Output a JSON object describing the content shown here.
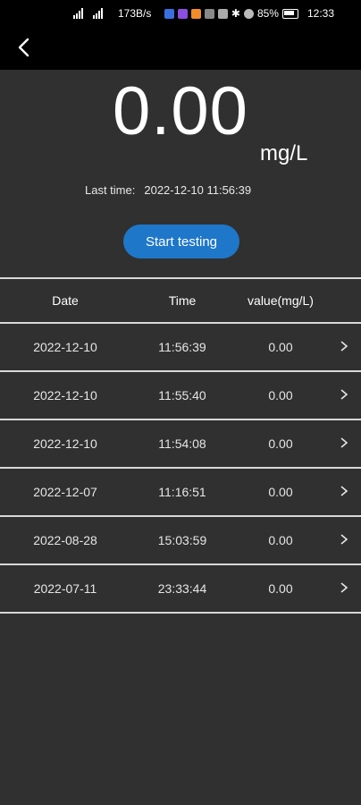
{
  "status_bar": {
    "net_speed": "173B/s",
    "battery": "85%",
    "clock": "12:33"
  },
  "reading": {
    "value": "0.00",
    "unit": "mg/L",
    "last_time_label": "Last time:",
    "last_time_value": "2022-12-10 11:56:39"
  },
  "actions": {
    "start_label": "Start testing"
  },
  "table": {
    "headers": [
      "Date",
      "Time",
      "value(mg/L)"
    ],
    "rows": [
      {
        "date": "2022-12-10",
        "time": "11:56:39",
        "value": "0.00"
      },
      {
        "date": "2022-12-10",
        "time": "11:55:40",
        "value": "0.00"
      },
      {
        "date": "2022-12-10",
        "time": "11:54:08",
        "value": "0.00"
      },
      {
        "date": "2022-12-07",
        "time": "11:16:51",
        "value": "0.00"
      },
      {
        "date": "2022-08-28",
        "time": "15:03:59",
        "value": "0.00"
      },
      {
        "date": "2022-07-11",
        "time": "23:33:44",
        "value": "0.00"
      }
    ]
  },
  "icons": {
    "back": "back-arrow-icon",
    "row_chevron": "chevron-right-icon"
  }
}
